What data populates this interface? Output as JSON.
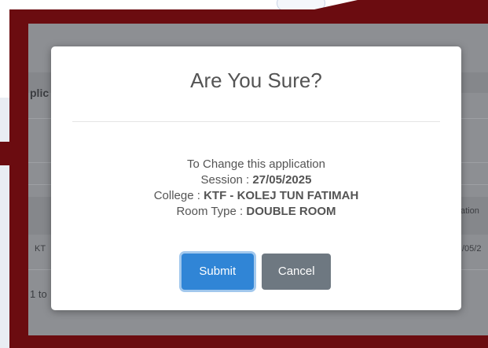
{
  "background": {
    "frame_color": "#6b0c10",
    "overlay_text": {
      "heading_fragment": "plic",
      "row_code_fragment": "KT",
      "paging_fragment": "1 to",
      "column_fragment": "ation",
      "date_fragment": "/05/2"
    }
  },
  "modal": {
    "title": "Are You Sure?",
    "intro": "To Change this application",
    "session_label": "Session : ",
    "session_value": "27/05/2025",
    "college_label": "College : ",
    "college_value": "KTF - KOLEJ TUN FATIMAH",
    "room_label": "Room Type : ",
    "room_value": "DOUBLE ROOM",
    "submit_label": "Submit",
    "cancel_label": "Cancel",
    "colors": {
      "submit": "#3085d6",
      "cancel": "#6e7881"
    }
  }
}
